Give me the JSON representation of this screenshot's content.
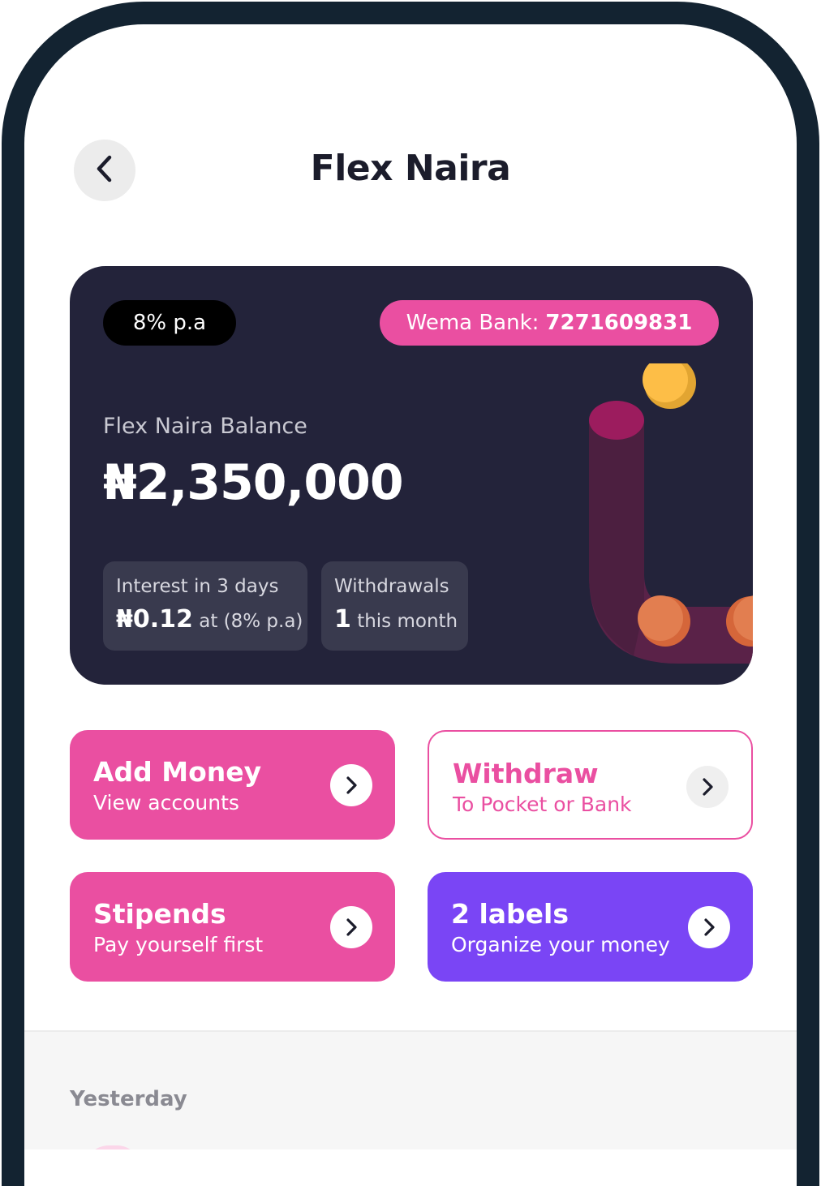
{
  "header": {
    "title": "Flex Naira",
    "back_icon": "chevron-left-icon"
  },
  "balance_card": {
    "rate_badge": "8% p.a",
    "bank_prefix": "Wema Bank:",
    "bank_account": "7271609831",
    "balance_label": "Flex Naira Balance",
    "balance_value": "₦2,350,000",
    "interest": {
      "label": "Interest in 3 days",
      "amount": "₦0.12",
      "suffix": "at (8% p.a)"
    },
    "withdrawals": {
      "label": "Withdrawals",
      "count": "1",
      "suffix": "this month"
    },
    "colors": {
      "card_bg": "#23233a",
      "accent_pink": "#ea4fa1",
      "coin_yellow": "#fdbe47",
      "coin_orange": "#e27e50",
      "tube_magenta": "#9c1c5e"
    }
  },
  "actions": [
    {
      "title": "Add Money",
      "subtitle": "View accounts",
      "icon": "chevron-right-icon"
    },
    {
      "title": "Withdraw",
      "subtitle": "To Pocket or Bank",
      "icon": "chevron-right-icon"
    },
    {
      "title": "Stipends",
      "subtitle": "Pay yourself first",
      "icon": "chevron-right-icon"
    },
    {
      "title": "2 labels",
      "subtitle": "Organize your money",
      "icon": "chevron-right-icon"
    }
  ],
  "action_colors": {
    "pink": "#ea4fa1",
    "purple": "#7a45f5"
  },
  "history": {
    "date_header": "Yesterday"
  }
}
